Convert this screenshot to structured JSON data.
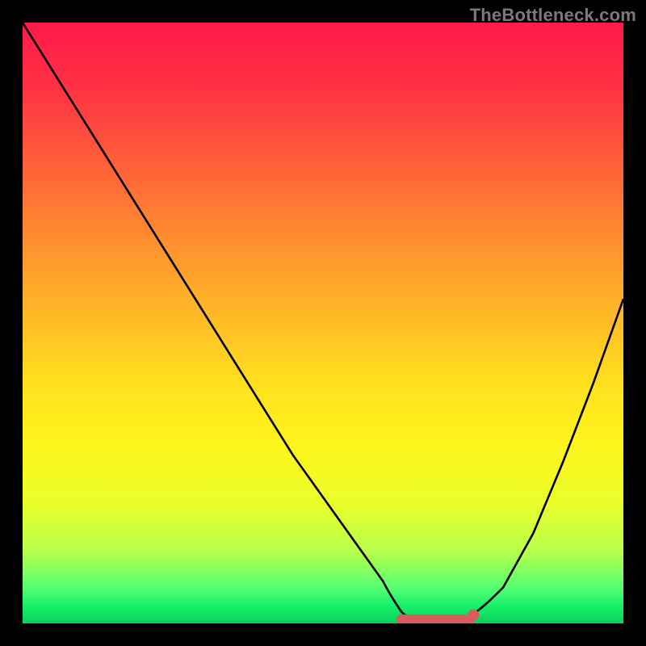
{
  "watermark": {
    "text": "TheBottleneck.com"
  },
  "colors": {
    "page_bg": "#000000",
    "curve": "#000000",
    "marker": "#d95c5c"
  },
  "chart_data": {
    "type": "line",
    "title": "",
    "xlabel": "",
    "ylabel": "",
    "xlim": [
      0,
      100
    ],
    "ylim": [
      0,
      100
    ],
    "grid": false,
    "series": [
      {
        "name": "bottleneck-curve",
        "x": [
          0,
          5,
          10,
          15,
          20,
          25,
          30,
          35,
          40,
          45,
          50,
          55,
          60,
          62,
          65,
          68,
          70,
          72,
          75,
          80,
          85,
          90,
          95,
          100
        ],
        "y": [
          100,
          92,
          84,
          76,
          68,
          60,
          52,
          44,
          36,
          28,
          21,
          14,
          7,
          4,
          1.5,
          0.5,
          0.3,
          0.3,
          1.0,
          6,
          15,
          27,
          40,
          54
        ]
      }
    ],
    "annotations": [
      {
        "name": "sweet-spot-marker",
        "shape": "capsule",
        "x_start": 62,
        "x_end": 75,
        "y": 0.4,
        "color": "#d95c5c"
      }
    ]
  }
}
